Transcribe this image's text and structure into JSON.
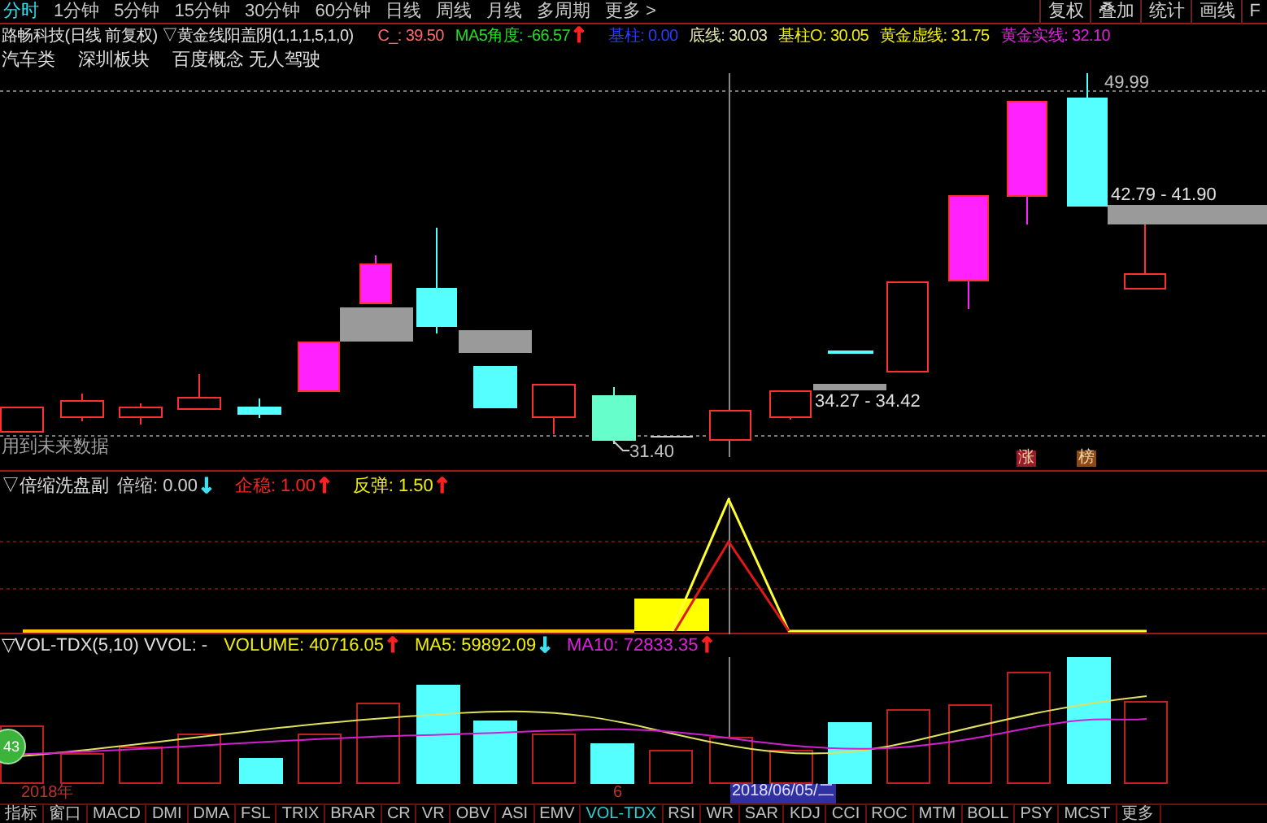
{
  "period_tabs": [
    {
      "label": "分时",
      "selected": true
    },
    {
      "label": "1分钟",
      "selected": false
    },
    {
      "label": "5分钟",
      "selected": false
    },
    {
      "label": "15分钟",
      "selected": false
    },
    {
      "label": "30分钟",
      "selected": false
    },
    {
      "label": "60分钟",
      "selected": false
    },
    {
      "label": "日线",
      "selected": false
    },
    {
      "label": "周线",
      "selected": false
    },
    {
      "label": "月线",
      "selected": false
    },
    {
      "label": "多周期",
      "selected": false
    },
    {
      "label": "更多 >",
      "selected": false
    }
  ],
  "tool_buttons": [
    "复权",
    "叠加",
    "统计",
    "画线",
    "F"
  ],
  "main_header": {
    "title": "路畅科技(日线 前复权) ▽黄金线阳盖阴(1,1,1,5,1,0)",
    "values": [
      {
        "text": "C_: 39.50",
        "color": "#ff6b6b"
      },
      {
        "text": "MA5角度: -66.57",
        "color": "#22dd22",
        "arrow": {
          "text": "↑",
          "color": "#ff2020"
        }
      },
      {
        "text": "基柱: 0.00",
        "color": "#2a3cff"
      },
      {
        "text": "底线: 30.03",
        "color": "#e8e8b0"
      },
      {
        "text": "基柱O: 30.05",
        "color": "#f0f000"
      },
      {
        "text": "黄金虚线: 31.75",
        "color": "#f0f000"
      },
      {
        "text": "黄金实线: 32.10",
        "color": "#e020e0"
      }
    ]
  },
  "sectors": [
    "汽车类",
    "深圳板块",
    "百度概念 无人驾驶"
  ],
  "main_chart": {
    "labels": [
      {
        "kind": "high",
        "text": "49.99"
      },
      {
        "kind": "range_a",
        "text": "42.79 - 41.90"
      },
      {
        "kind": "range_b",
        "text": "34.27 - 34.42"
      },
      {
        "kind": "low",
        "text": "31.40"
      },
      {
        "kind": "warning",
        "text": "用到未来数据"
      }
    ],
    "badges": [
      {
        "text": "涨",
        "color": "#9a1a2a"
      },
      {
        "text": "榜",
        "color": "#8a4a1a"
      }
    ]
  },
  "indicator": {
    "name": "▽倍缩洗盘副",
    "values": [
      {
        "text": "倍缩: 0.00",
        "color": "#d0d0d0",
        "arrow": {
          "text": "↓",
          "color": "#40e0f0"
        }
      },
      {
        "text": "企稳: 1.00",
        "color": "#ff2020",
        "arrow": {
          "text": "↑",
          "color": "#ff2020"
        }
      },
      {
        "text": "反弹: 1.50",
        "color": "#f0f000",
        "arrow": {
          "text": "↑",
          "color": "#ff2020"
        }
      }
    ]
  },
  "volume": {
    "name": "▽VOL-TDX(5,10) VVOL: -",
    "values": [
      {
        "text": "VOLUME: 40716.05",
        "color": "#f0f000",
        "arrow": {
          "text": "↑",
          "color": "#ff2020"
        }
      },
      {
        "text": "MA5: 59892.09",
        "color": "#f0f000",
        "arrow": {
          "text": "↓",
          "color": "#40e0f0"
        }
      },
      {
        "text": "MA10: 72833.35",
        "color": "#e020e0",
        "arrow": {
          "text": "↑",
          "color": "#ff2020"
        }
      }
    ],
    "marker": "43"
  },
  "date_axis": {
    "year": "2018年",
    "month": "6",
    "cursor_date": "2018/06/05/二"
  },
  "indicator_tabs": [
    {
      "label": "指标",
      "selected": false
    },
    {
      "label": "窗口",
      "selected": false
    },
    {
      "label": "MACD",
      "selected": false
    },
    {
      "label": "DMI",
      "selected": false
    },
    {
      "label": "DMA",
      "selected": false
    },
    {
      "label": "FSL",
      "selected": false
    },
    {
      "label": "TRIX",
      "selected": false
    },
    {
      "label": "BRAR",
      "selected": false
    },
    {
      "label": "CR",
      "selected": false
    },
    {
      "label": "VR",
      "selected": false
    },
    {
      "label": "OBV",
      "selected": false
    },
    {
      "label": "ASI",
      "selected": false
    },
    {
      "label": "EMV",
      "selected": false
    },
    {
      "label": "VOL-TDX",
      "selected": true
    },
    {
      "label": "RSI",
      "selected": false
    },
    {
      "label": "WR",
      "selected": false
    },
    {
      "label": "SAR",
      "selected": false
    },
    {
      "label": "KDJ",
      "selected": false
    },
    {
      "label": "CCI",
      "selected": false
    },
    {
      "label": "ROC",
      "selected": false
    },
    {
      "label": "MTM",
      "selected": false
    },
    {
      "label": "BOLL",
      "selected": false
    },
    {
      "label": "PSY",
      "selected": false
    },
    {
      "label": "MCST",
      "selected": false
    },
    {
      "label": "更多",
      "selected": false
    }
  ]
}
